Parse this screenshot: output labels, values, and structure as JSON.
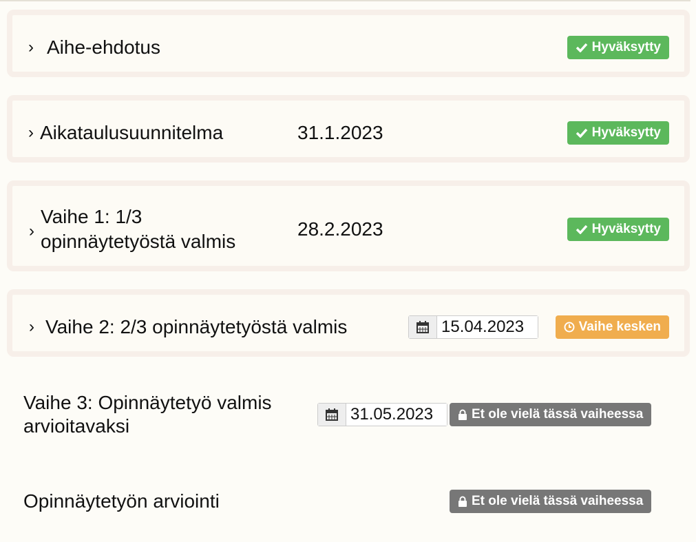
{
  "colors": {
    "success": "#5cb85c",
    "warning": "#f0ad4e",
    "locked": "#777777",
    "card_border": "#f7efe9"
  },
  "steps": [
    {
      "title": "Aihe-ehdotus",
      "status": {
        "label": "Hyväksytty",
        "icon": "check-icon"
      }
    },
    {
      "title": "Aikataulusuunnitelma",
      "date": "31.1.2023",
      "status": {
        "label": "Hyväksytty",
        "icon": "check-icon"
      }
    },
    {
      "title_lines": [
        "Vaihe 1: 1/3",
        "opinnäytetyöstä valmis"
      ],
      "date": "28.2.2023",
      "status": {
        "label": "Hyväksytty",
        "icon": "check-icon"
      }
    },
    {
      "title": "Vaihe 2: 2/3 opinnäytetyöstä valmis",
      "date_value": "15.04.2023",
      "status": {
        "label": "Vaihe kesken",
        "icon": "clock-icon"
      }
    },
    {
      "title_lines": [
        "Vaihe 3: Opinnäytetyö valmis",
        "arvioitavaksi"
      ],
      "date_value": "31.05.2023",
      "status": {
        "label": "Et ole vielä tässä vaiheessa",
        "icon": "lock-icon"
      }
    },
    {
      "title": "Opinnäytetyön arviointi",
      "status": {
        "label": "Et ole vielä tässä vaiheessa",
        "icon": "lock-icon"
      }
    }
  ]
}
